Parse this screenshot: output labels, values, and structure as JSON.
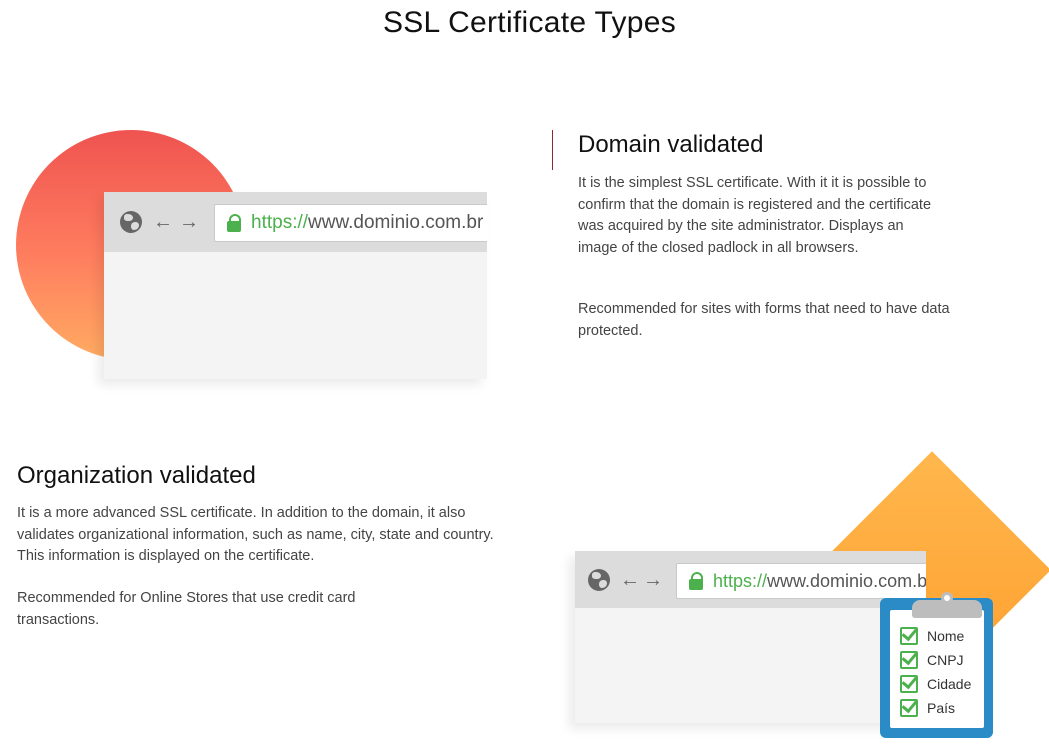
{
  "page": {
    "title": "SSL Certificate Types"
  },
  "browser_illustration": {
    "url_protocol": "https://",
    "url_domain": "www.dominio.com.br",
    "icons": [
      "globe-icon",
      "back-arrow-icon",
      "forward-arrow-icon",
      "padlock-icon"
    ]
  },
  "clipboard": {
    "items": [
      "Nome",
      "CNPJ",
      "Cidade",
      "País"
    ]
  },
  "sections": {
    "domain_validated": {
      "heading": "Domain validated",
      "description": "It is the simplest SSL certificate. With it it is possible to confirm that the domain is registered and the certificate was acquired by the site administrator. Displays an image of the closed padlock in all browsers.",
      "recommendation": "Recommended for sites with forms that need to have data protected."
    },
    "organization_validated": {
      "heading": "Organization validated",
      "description": "It is a more advanced SSL certificate. In addition to the domain, it also validates organizational information, such as name, city, state and country. This information is displayed on the certificate.",
      "recommendation": "Recommended for Online Stores that use credit card transactions."
    }
  },
  "colors": {
    "accent_green": "#4cb04c",
    "circle_gradient": [
      "#ef5350",
      "#ffab62"
    ],
    "diamond": "#ffab40",
    "clipboard_blue": "#2a8bc6"
  }
}
